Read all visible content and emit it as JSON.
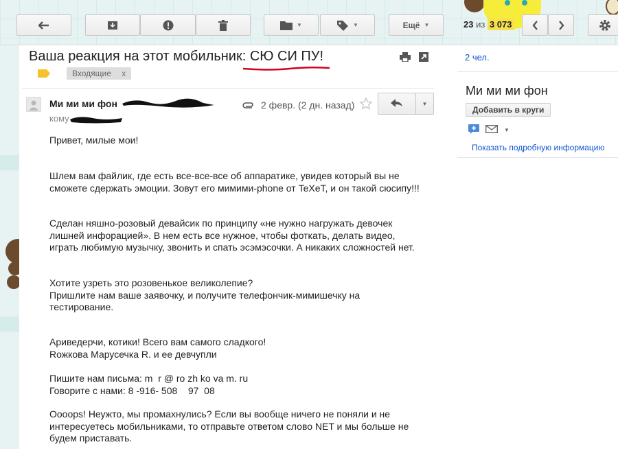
{
  "toolbar": {
    "more_label": "Ещё",
    "pager": {
      "current": "23",
      "of_word": "из",
      "total": "3 073"
    }
  },
  "subject": {
    "prefix": "Ваша реакция на этот мобильник: ",
    "highlight": "СЮ СИ ПУ!"
  },
  "labels": {
    "inbox": "Входящие",
    "remove": "x"
  },
  "message": {
    "sender": "Ми ми ми фон",
    "to_prefix": "кому",
    "date": "2 февр. (2 дн. назад)",
    "paragraphs": [
      "Привет, милые мои!",
      "Шлем вам файлик, где есть все-все-все об аппаратике, увидев который вы не сможете сдержать эмоции. Зовут его мимими-phone от TeXeT, и он такой сюсипу!!!",
      "Сделан няшно-розовый девайсик по принципу «не нужно нагружать девочек лишней инфорацией». В нем есть все нужное, чтобы фоткать, делать видео, играть любимую музычку, звонить и спать эсэмэсочки. А никаких сложностей нет.",
      "Хотите узреть это розовенькое великолепие?\nПришлите нам ваше заявочку, и получите телефончик-мимишечку на тестирование.",
      "Ариведерчи, котики! Всего вам самого сладкого!\nRожкова Марусечка R. и ее девчупли",
      "Пишите нам письма: m  r @ ro zh ko va m. ru\nГоворите с нами: 8 -916- 508    97  08",
      "Oooops! Неужто, мы промахнулись? Если вы вообще ничего не поняли и не интересуетесь мобильниками, то отправьте ответом слово NET и мы больше не будем приставать."
    ]
  },
  "right_panel": {
    "people_count": "2 чел.",
    "contact_name": "Ми ми ми фон",
    "add_to_circles": "Добавить в круги",
    "show_details": "Показать подробную информацию"
  },
  "colors": {
    "toolbar_bg": "#e6f3f2",
    "link": "#1155cc",
    "pager_highlight": "#f9e04b",
    "subject_underline": "#d0021b"
  }
}
